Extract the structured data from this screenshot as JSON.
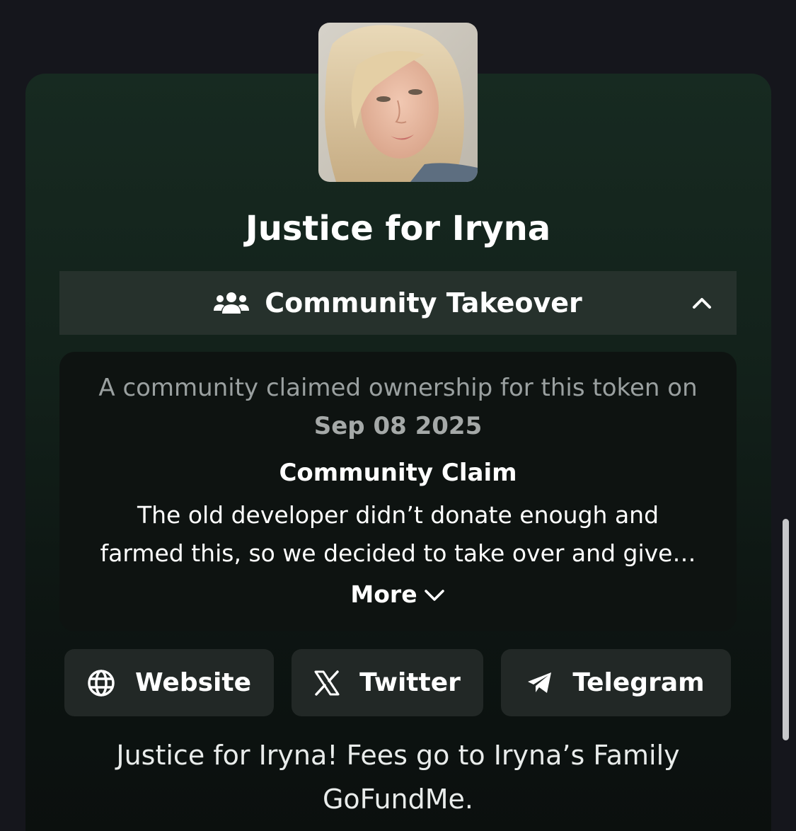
{
  "token": {
    "name": "Justice for Iryna",
    "avatar_alt": "token-avatar-photo"
  },
  "cto": {
    "label": "Community Takeover",
    "icon": "people-icon",
    "toggle_icon": "chevron-up-icon",
    "intro": "A community claimed ownership for this token on",
    "date": "Sep 08 2025",
    "claim_heading": "Community Claim",
    "claim_lines": [
      "The old developer didn’t donate enough and",
      "farmed this, so we decided to take over and give…"
    ],
    "more_label": "More",
    "more_icon": "chevron-down-icon"
  },
  "links": [
    {
      "label": "Website",
      "icon": "globe-icon"
    },
    {
      "label": "Twitter",
      "icon": "x-logo-icon"
    },
    {
      "label": "Telegram",
      "icon": "telegram-icon"
    }
  ],
  "description": "Justice for Iryna! Fees go to Iryna’s Family GoFundMe.",
  "colors": {
    "page_bg": "#15161c",
    "card_top": "#172a21",
    "panel_bg": "#0e1311",
    "button_bg": "#222826"
  }
}
